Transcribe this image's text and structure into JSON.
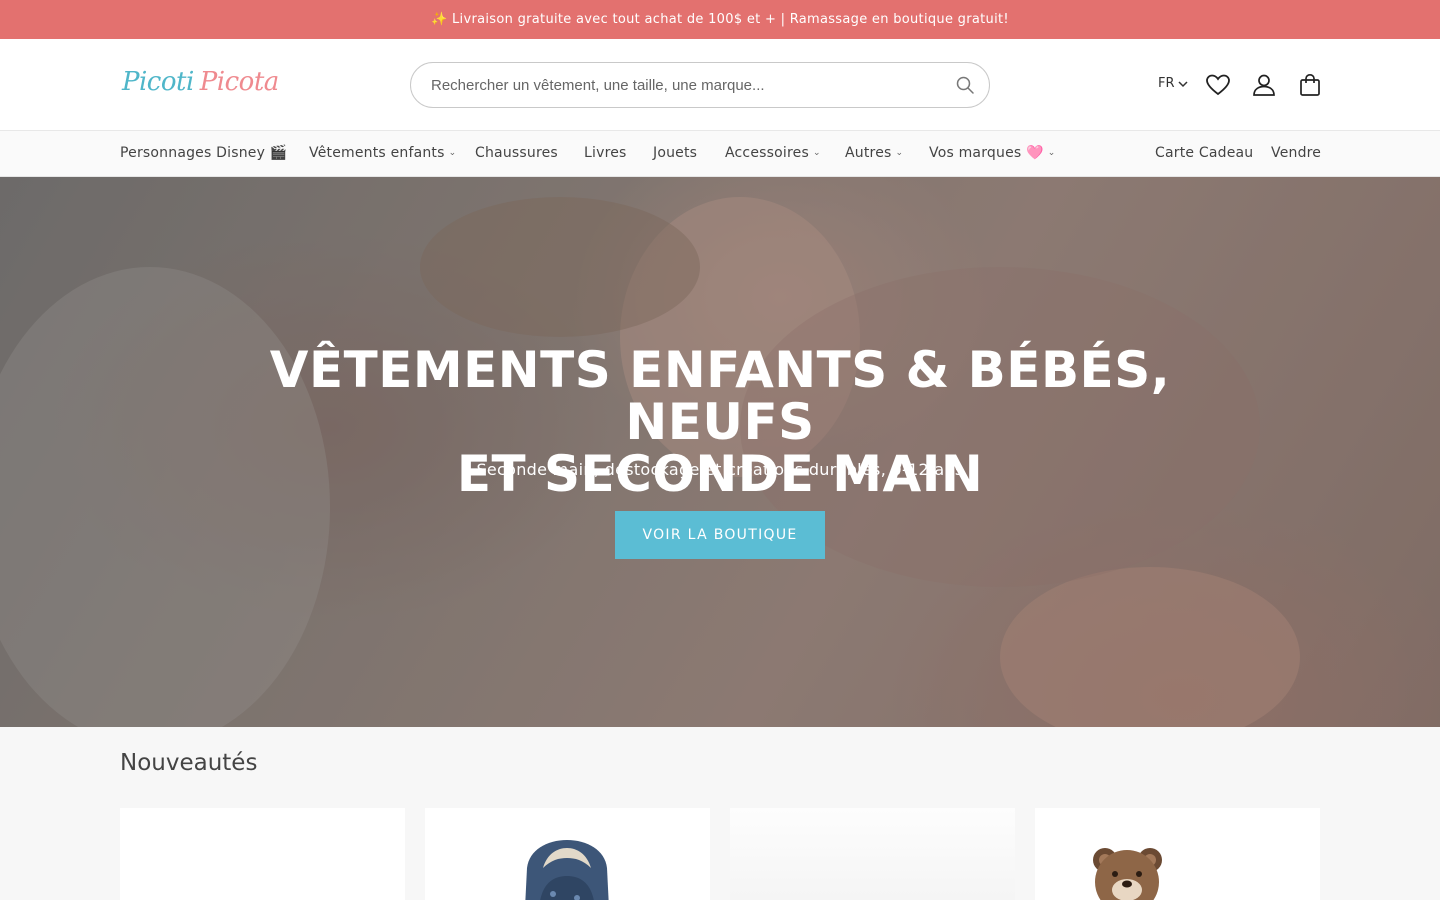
{
  "announcement": "✨ Livraison gratuite avec tout achat de 100$ et + | Ramassage en boutique gratuit!",
  "logo": {
    "part1": "Picoti",
    "part2": "Picota"
  },
  "search": {
    "placeholder": "Rechercher un vêtement, une taille, une marque...",
    "value": ""
  },
  "header": {
    "language": "FR"
  },
  "nav": {
    "left": [
      {
        "label": "Personnages Disney 🎬",
        "dropdown": false
      },
      {
        "label": "Vêtements enfants",
        "dropdown": true
      },
      {
        "label": "Chaussures",
        "dropdown": false
      },
      {
        "label": "Livres",
        "dropdown": false
      },
      {
        "label": "Jouets",
        "dropdown": false
      },
      {
        "label": "Accessoires",
        "dropdown": true
      },
      {
        "label": "Autres",
        "dropdown": true
      },
      {
        "label": "Vos marques 🩷",
        "dropdown": true
      }
    ],
    "right": [
      {
        "label": "Carte Cadeau"
      },
      {
        "label": "Vendre"
      }
    ]
  },
  "hero": {
    "title_line1": "VÊTEMENTS ENFANTS & BÉBÉS, NEUFS",
    "title_line2": "ET SECONDE MAIN",
    "subtitle": "Seconde main, déstockage et créations durables, 0-12 ans",
    "cta": "VOIR LA BOUTIQUE"
  },
  "new_arrivals": {
    "title": "Nouveautés",
    "cards": [
      {
        "image": "blank-product"
      },
      {
        "image": "jacket-product"
      },
      {
        "image": "white-clothing-product"
      },
      {
        "image": "bear-toy-product"
      }
    ]
  },
  "colors": {
    "announcement_bg": "#e3716f",
    "cta_bg": "#5bbdd4",
    "logo_blue": "#4fb6c9",
    "logo_pink": "#ef8a8f"
  }
}
